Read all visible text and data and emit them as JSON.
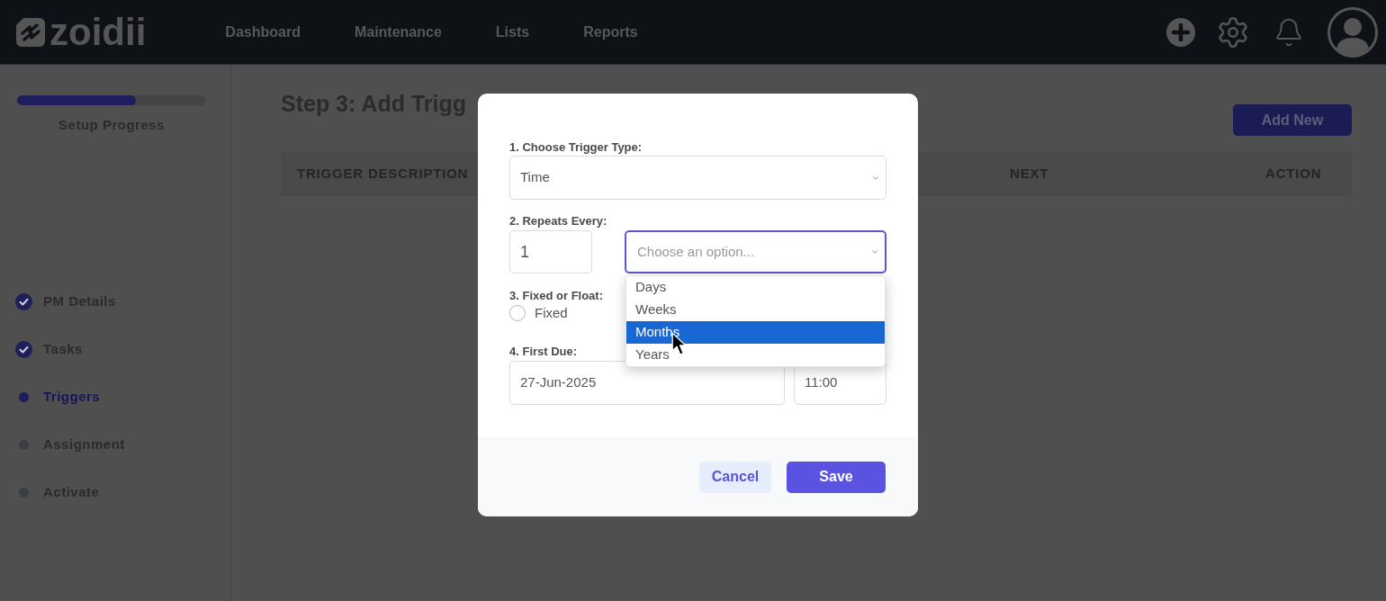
{
  "header": {
    "logo": "zoidii",
    "nav": [
      "Dashboard",
      "Maintenance",
      "Lists",
      "Reports"
    ]
  },
  "sidebar": {
    "progress": {
      "level": 0.63,
      "label": "Setup Progress"
    },
    "steps": [
      {
        "label": "PM Details",
        "completed": true,
        "selected": false
      },
      {
        "label": "Tasks",
        "completed": true,
        "selected": false
      },
      {
        "label": "Triggers",
        "completed": false,
        "selected": true
      },
      {
        "label": "Assignment",
        "completed": false,
        "selected": false
      },
      {
        "label": "Activate",
        "completed": false,
        "selected": false
      }
    ]
  },
  "page": {
    "title": "Step 3: Add Trigg",
    "add_button": "Add New",
    "table": {
      "columns": [
        "TRIGGER DESCRIPTION",
        "NEXT",
        "ACTION"
      ]
    }
  },
  "modal": {
    "trigger_type": {
      "label": "1. Choose Trigger Type:",
      "value": "Time"
    },
    "repeats": {
      "label": "2. Repeats Every:",
      "count": "1",
      "unit": {
        "placeholder": "Choose an option...",
        "focused": true,
        "expanded": true,
        "options": [
          {
            "label": "Days",
            "selected": false
          },
          {
            "label": "Weeks",
            "selected": false
          },
          {
            "label": "Months",
            "selected": true
          },
          {
            "label": "Years",
            "selected": false
          }
        ]
      }
    },
    "fixed_or_float": {
      "label": "3. Fixed or Float:",
      "options": [
        {
          "label": "Fixed",
          "checked": false
        }
      ]
    },
    "first_due": {
      "label": "4. First Due:",
      "date": "27-Jun-2025",
      "time": "11:00"
    },
    "buttons": [
      {
        "label": "Cancel",
        "kind": "secondary"
      },
      {
        "label": "Save",
        "kind": "primary"
      }
    ]
  }
}
